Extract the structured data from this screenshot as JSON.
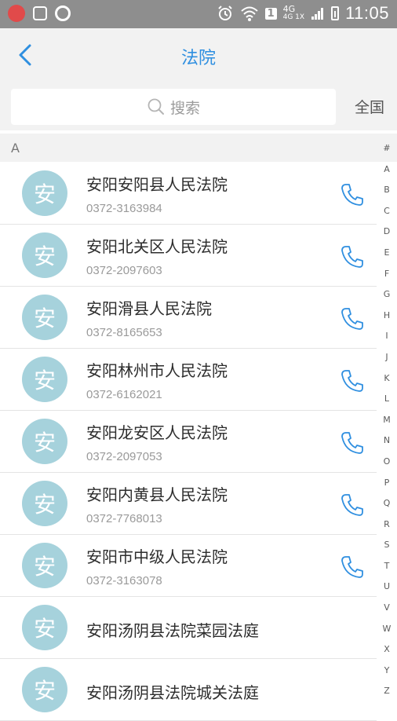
{
  "status_bar": {
    "signal_label_top": "4G",
    "signal_label_bottom": "4G 1X",
    "sim": "1",
    "time": "11:05"
  },
  "header": {
    "title": "法院"
  },
  "search": {
    "placeholder": "搜索",
    "region_label": "全国"
  },
  "section": {
    "letter": "A"
  },
  "list": [
    {
      "avatar": "安",
      "name": "安阳安阳县人民法院",
      "phone": "0372-3163984",
      "has_call": true
    },
    {
      "avatar": "安",
      "name": "安阳北关区人民法院",
      "phone": "0372-2097603",
      "has_call": true
    },
    {
      "avatar": "安",
      "name": "安阳滑县人民法院",
      "phone": "0372-8165653",
      "has_call": true
    },
    {
      "avatar": "安",
      "name": "安阳林州市人民法院",
      "phone": "0372-6162021",
      "has_call": true
    },
    {
      "avatar": "安",
      "name": "安阳龙安区人民法院",
      "phone": "0372-2097053",
      "has_call": true
    },
    {
      "avatar": "安",
      "name": "安阳内黄县人民法院",
      "phone": "0372-7768013",
      "has_call": true
    },
    {
      "avatar": "安",
      "name": "安阳市中级人民法院",
      "phone": "0372-3163078",
      "has_call": true
    },
    {
      "avatar": "安",
      "name": "安阳汤阴县法院菜园法庭",
      "phone": "",
      "has_call": false
    },
    {
      "avatar": "安",
      "name": "安阳汤阴县法院城关法庭",
      "phone": "",
      "has_call": false
    }
  ],
  "index_bar": [
    "#",
    "A",
    "B",
    "C",
    "D",
    "E",
    "F",
    "G",
    "H",
    "I",
    "J",
    "K",
    "L",
    "M",
    "N",
    "O",
    "P",
    "Q",
    "R",
    "S",
    "T",
    "U",
    "V",
    "W",
    "X",
    "Y",
    "Z"
  ],
  "colors": {
    "accent": "#2f8fe0",
    "avatar_bg": "#a6d2dc",
    "status_bar": "#8e8e8e"
  }
}
